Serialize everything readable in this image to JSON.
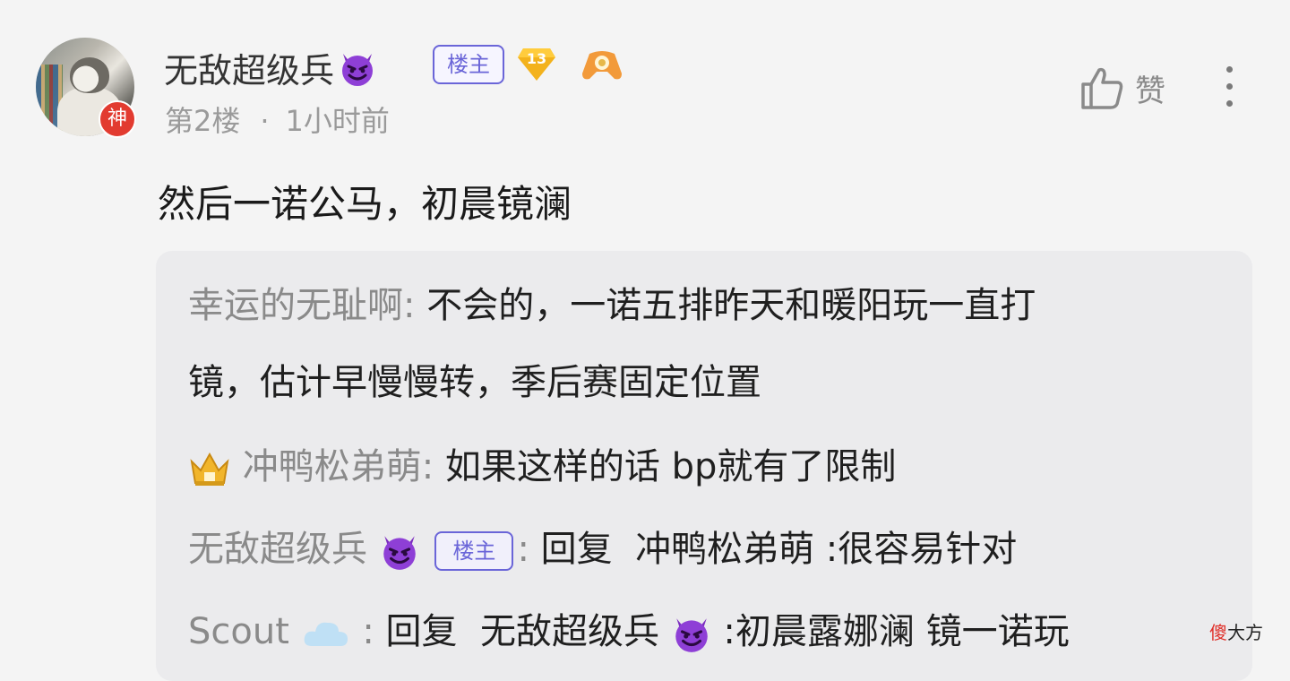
{
  "post": {
    "avatar_badge": "神",
    "username": "无敌超级兵",
    "owner_tag": "楼主",
    "level": "13",
    "floor": "第2楼",
    "separator": "·",
    "time": "1小时前",
    "like_label": "赞",
    "content": "然后一诺公马，初晨镜澜"
  },
  "replies": [
    {
      "name": "幸运的无耻啊",
      "colon": ": ",
      "text_line1": "不会的，一诺五排昨天和暖阳玩一直打",
      "text_line2": "镜，估计早慢慢转，季后赛固定位置"
    },
    {
      "name": "冲鸭松弟萌",
      "colon": ": ",
      "text": "如果这样的话 bp就有了限制"
    },
    {
      "name": "无敌超级兵",
      "tag": "楼主",
      "colon": ": ",
      "reply_word": "回复",
      "target": "冲鸭松弟萌",
      "text": " :很容易针对"
    },
    {
      "name": "Scout",
      "colon": ": ",
      "reply_word": "回复",
      "target": "无敌超级兵",
      "text": " :初晨露娜澜 镜一诺玩"
    }
  ],
  "watermark": {
    "first": "傻",
    "rest": "大方"
  },
  "colors": {
    "accent": "#6a65d8",
    "badge_red": "#e23b30",
    "muted": "#8a8a8a"
  },
  "icons": [
    "devil-emoji-icon",
    "level-diamond-icon",
    "game-controller-icon",
    "thumbs-up-icon",
    "more-vertical-icon",
    "crown-icon",
    "cloud-icon"
  ]
}
